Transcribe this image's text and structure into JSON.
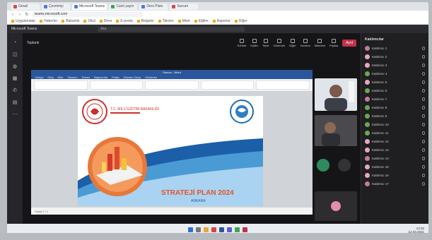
{
  "browser": {
    "tabs": [
      {
        "label": "Gmail",
        "active": false
      },
      {
        "label": "Çevrimiçi",
        "active": false
      },
      {
        "label": "Microsoft Teams",
        "active": true
      },
      {
        "label": "Canlı yayın",
        "active": false
      },
      {
        "label": "Ders Planı",
        "active": false
      },
      {
        "label": "Sunum",
        "active": false
      }
    ],
    "url": "teams.microsoft.com",
    "bookmarks": [
      "Uygulamalar",
      "Haberler",
      "Bakanlık",
      "Okul",
      "Drive",
      "E-posta",
      "Belgeler",
      "Takvim",
      "Meet",
      "Eğitim",
      "Raporlar",
      "Diğer"
    ]
  },
  "teams": {
    "app_title": "Microsoft Teams",
    "search_placeholder": "Ara",
    "meeting_title": "Toplantı",
    "tools": [
      "Sohbet",
      "Kişiler",
      "Tepki",
      "Görünüm",
      "Diğer",
      "Kamera",
      "Mikrofon",
      "Paylaş"
    ],
    "leave_label": "Ayrıl",
    "panel_title": "Katılımcılar",
    "participants": [
      {
        "name": "Katılımcı 1",
        "color": "#c27ba0"
      },
      {
        "name": "Katılımcı 2",
        "color": "#e6a8c0"
      },
      {
        "name": "Katılımcı 3",
        "color": "#e6a8c0"
      },
      {
        "name": "Katılımcı 4",
        "color": "#6aa84f"
      },
      {
        "name": "Katılımcı 5",
        "color": "#e6a8c0"
      },
      {
        "name": "Katılımcı 6",
        "color": "#6aa84f"
      },
      {
        "name": "Katılımcı 7",
        "color": "#c27ba0"
      },
      {
        "name": "Katılımcı 8",
        "color": "#6aa84f"
      },
      {
        "name": "Katılımcı 9",
        "color": "#6aa84f"
      },
      {
        "name": "Katılımcı 10",
        "color": "#6aa84f"
      },
      {
        "name": "Katılımcı 11",
        "color": "#6aa84f"
      },
      {
        "name": "Katılımcı 12",
        "color": "#e6a8c0"
      },
      {
        "name": "Katılımcı 13",
        "color": "#e6a8c0"
      },
      {
        "name": "Katılımcı 14",
        "color": "#c27ba0"
      },
      {
        "name": "Katılımcı 15",
        "color": "#e6a8c0"
      },
      {
        "name": "Katılımcı 16",
        "color": "#e6a8c0"
      },
      {
        "name": "Katılımcı 17",
        "color": "#c27ba0"
      }
    ]
  },
  "word": {
    "title": "Sunum - Word",
    "ribbon_tabs": [
      "Dosya",
      "Giriş",
      "Ekle",
      "Tasarım",
      "Düzen",
      "Başvurular",
      "Posta",
      "Gözden Geçir",
      "Görünüm"
    ],
    "status": "Sayfa 1 / 1"
  },
  "slide": {
    "org_text": "T.C. MİLLÎ EĞİTİM BAKANLIĞI",
    "banner_text": "STRATEJİ PLAN 2024",
    "banner_sub": "ANKARA"
  },
  "taskbar": {
    "time": "14:32",
    "date": "12.03.2021"
  }
}
